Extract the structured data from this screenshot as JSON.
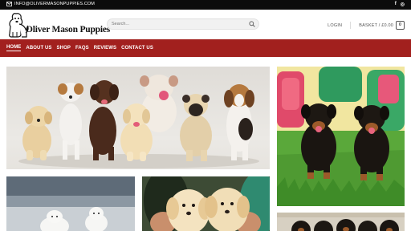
{
  "topbar": {
    "email": "INFO@OLIVERMASONPUPPIES.COM",
    "social": {
      "facebook": "f",
      "instagram": "◎"
    }
  },
  "header": {
    "logo_text": "Oliver Mason Puppies",
    "search": {
      "placeholder": "Search..."
    },
    "login_label": "LOGIN",
    "basket_label": "BASKET / £0.00",
    "cart_count": "0"
  },
  "nav": {
    "items": [
      "HOME",
      "ABOUT US",
      "SHOP",
      "FAQS",
      "REVIEWS",
      "CONTACT US"
    ],
    "active": "HOME"
  },
  "icons": [
    "mail-icon",
    "facebook-icon",
    "instagram-icon",
    "search-icon",
    "logo-dog-icon"
  ],
  "colors": {
    "topbar": "#0c0c0c",
    "nav": "#a2201e",
    "text_dark": "#111111",
    "link_grey": "#555555"
  },
  "images": [
    {
      "name": "puppy-group-photo",
      "subject": "group of mixed-breed puppies"
    },
    {
      "name": "rottweiler-puppies-photo",
      "subject": "rottweiler puppies on grass"
    },
    {
      "name": "white-puppies-photo",
      "subject": "white fluffy puppies"
    },
    {
      "name": "golden-retriever-puppies-photo",
      "subject": "golden retriever puppies held in hands"
    },
    {
      "name": "rottweiler-litter-photo",
      "subject": "rottweiler litter"
    }
  ]
}
